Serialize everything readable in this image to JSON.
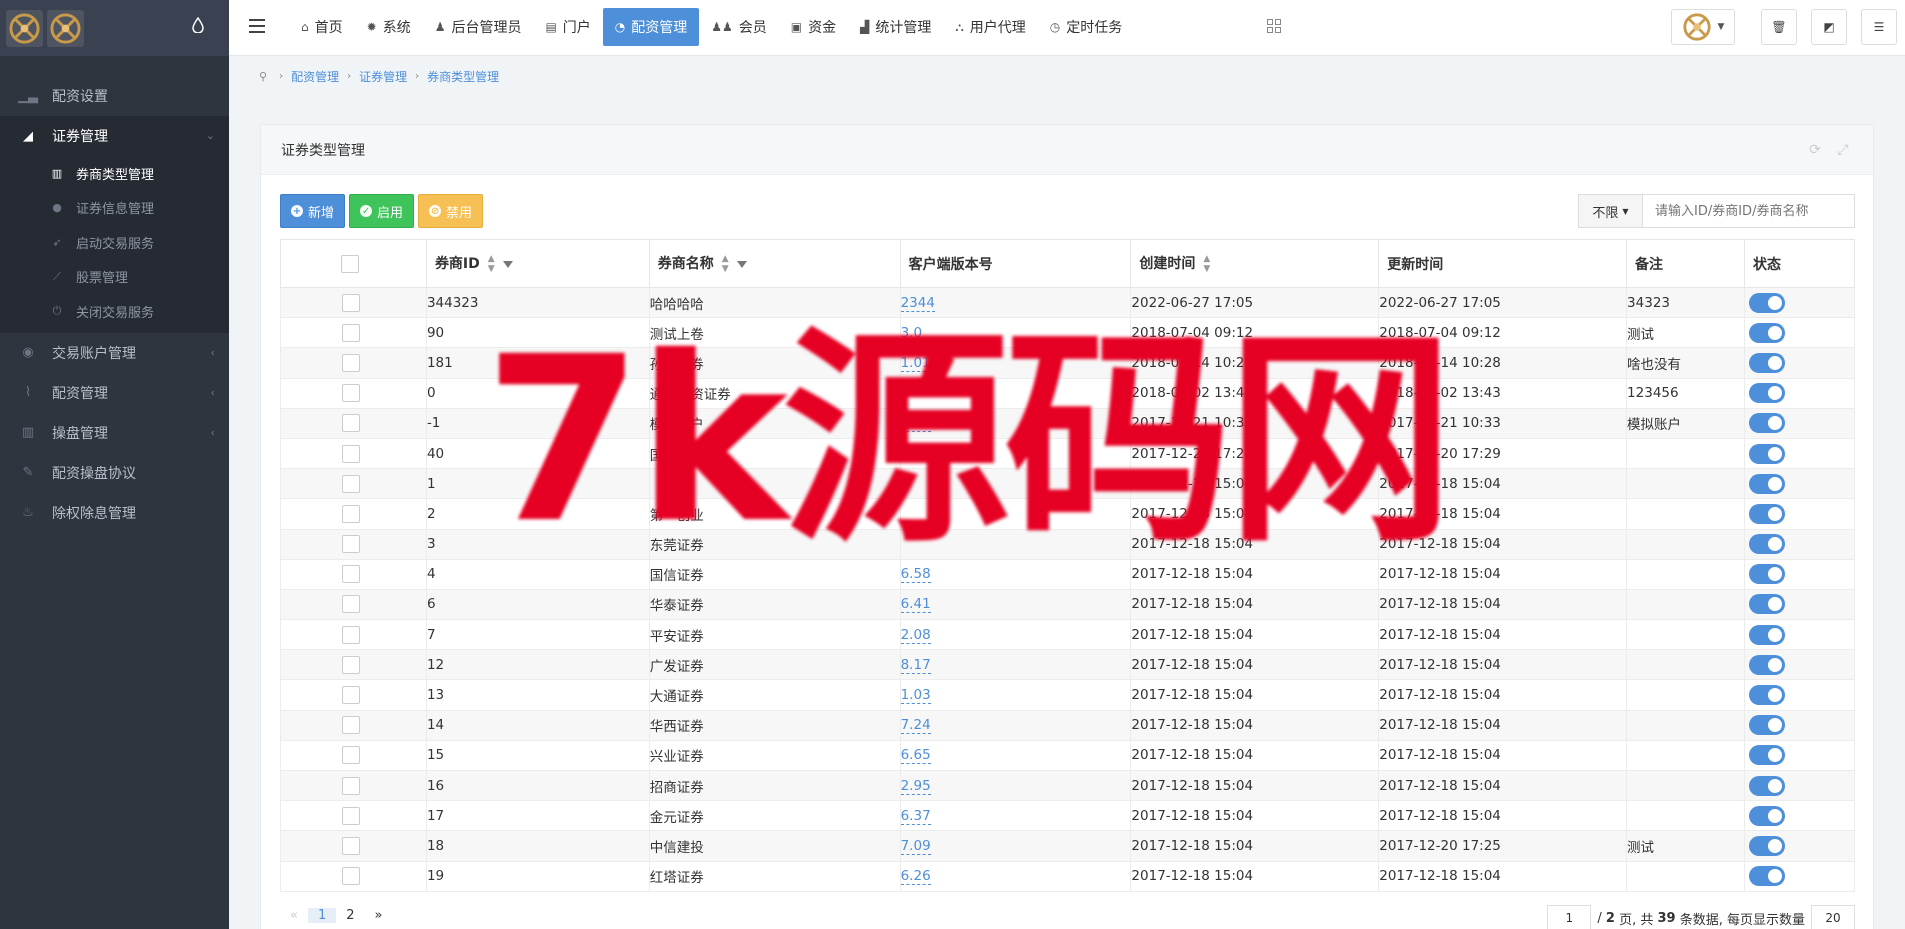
{
  "sidebar": {
    "menu": [
      {
        "label": "配资设置",
        "icon": "bar-chart-icon"
      },
      {
        "label": "证券管理",
        "icon": "area-chart-icon"
      },
      {
        "label": "交易账户管理",
        "icon": "user-circle-icon"
      },
      {
        "label": "配资管理",
        "icon": "paperclip-icon"
      },
      {
        "label": "操盘管理",
        "icon": "bank-icon"
      },
      {
        "label": "配资操盘协议",
        "icon": "pencil-icon"
      },
      {
        "label": "除权除息管理",
        "icon": "fire-icon"
      }
    ],
    "submenu": [
      {
        "label": "券商类型管理",
        "icon": "bank-icon"
      },
      {
        "label": "证券信息管理",
        "icon": "user-icon"
      },
      {
        "label": "启动交易服务",
        "icon": "rocket-icon"
      },
      {
        "label": "股票管理",
        "icon": "line-chart-icon"
      },
      {
        "label": "关闭交易服务",
        "icon": "power-icon"
      }
    ]
  },
  "topbar": {
    "nav": [
      {
        "label": "首页",
        "icon": "home-icon"
      },
      {
        "label": "系统",
        "icon": "gear-icon"
      },
      {
        "label": "后台管理员",
        "icon": "user-icon"
      },
      {
        "label": "门户",
        "icon": "newspaper-icon"
      },
      {
        "label": "配资管理",
        "icon": "pie-chart-icon"
      },
      {
        "label": "会员",
        "icon": "users-icon"
      },
      {
        "label": "资金",
        "icon": "money-icon"
      },
      {
        "label": "统计管理",
        "icon": "bar-chart-icon"
      },
      {
        "label": "用户代理",
        "icon": "sitemap-icon"
      },
      {
        "label": "定时任务",
        "icon": "clock-icon"
      }
    ]
  },
  "breadcrumb": [
    "配资管理",
    "证券管理",
    "券商类型管理"
  ],
  "panel": {
    "title": "证券类型管理",
    "buttons": {
      "add": "新增",
      "enable": "启用",
      "disable": "禁用"
    },
    "search": {
      "select_value": "不限",
      "placeholder": "请输入ID/券商ID/券商名称"
    }
  },
  "table": {
    "headers": {
      "id": "券商ID",
      "name": "券商名称",
      "version": "客户端版本号",
      "created": "创建时间",
      "updated": "更新时间",
      "remark": "备注",
      "status": "状态"
    },
    "rows": [
      {
        "id": "344323",
        "name": "哈哈哈哈",
        "version": "2344",
        "created": "2022-06-27 17:05",
        "updated": "2022-06-27 17:05",
        "remark": "34323"
      },
      {
        "id": "90",
        "name": "测试上卷",
        "version": "3.0",
        "created": "2018-07-04 09:12",
        "updated": "2018-07-04 09:12",
        "remark": "测试"
      },
      {
        "id": "181",
        "name": "孙凯证券",
        "version": "1.01",
        "created": "2018-06-14 10:28",
        "updated": "2018-06-14 10:28",
        "remark": "啥也没有"
      },
      {
        "id": "0",
        "name": "通道配资证券",
        "version": "",
        "created": "2018-06-02 13:43",
        "updated": "2018-06-02 13:43",
        "remark": "123456"
      },
      {
        "id": "-1",
        "name": "模拟账户",
        "version": "1.00",
        "created": "2017-12-21 10:33",
        "updated": "2017-12-21 10:33",
        "remark": "模拟账户"
      },
      {
        "id": "40",
        "name": "国金证券",
        "version": "",
        "created": "2017-12-20 17:28",
        "updated": "2017-12-20 17:29",
        "remark": ""
      },
      {
        "id": "1",
        "name": "",
        "version": "",
        "created": "2017-12-18 15:04",
        "updated": "2017-12-18 15:04",
        "remark": ""
      },
      {
        "id": "2",
        "name": "第一创业",
        "version": "",
        "created": "2017-12-18 15:04",
        "updated": "2017-12-18 15:04",
        "remark": ""
      },
      {
        "id": "3",
        "name": "东莞证券",
        "version": "",
        "created": "2017-12-18 15:04",
        "updated": "2017-12-18 15:04",
        "remark": ""
      },
      {
        "id": "4",
        "name": "国信证券",
        "version": "6.58",
        "created": "2017-12-18 15:04",
        "updated": "2017-12-18 15:04",
        "remark": ""
      },
      {
        "id": "6",
        "name": "华泰证券",
        "version": "6.41",
        "created": "2017-12-18 15:04",
        "updated": "2017-12-18 15:04",
        "remark": ""
      },
      {
        "id": "7",
        "name": "平安证券",
        "version": "2.08",
        "created": "2017-12-18 15:04",
        "updated": "2017-12-18 15:04",
        "remark": ""
      },
      {
        "id": "12",
        "name": "广发证券",
        "version": "8.17",
        "created": "2017-12-18 15:04",
        "updated": "2017-12-18 15:04",
        "remark": ""
      },
      {
        "id": "13",
        "name": "大通证券",
        "version": "1.03",
        "created": "2017-12-18 15:04",
        "updated": "2017-12-18 15:04",
        "remark": ""
      },
      {
        "id": "14",
        "name": "华西证券",
        "version": "7.24",
        "created": "2017-12-18 15:04",
        "updated": "2017-12-18 15:04",
        "remark": ""
      },
      {
        "id": "15",
        "name": "兴业证券",
        "version": "6.65",
        "created": "2017-12-18 15:04",
        "updated": "2017-12-18 15:04",
        "remark": ""
      },
      {
        "id": "16",
        "name": "招商证券",
        "version": "2.95",
        "created": "2017-12-18 15:04",
        "updated": "2017-12-18 15:04",
        "remark": ""
      },
      {
        "id": "17",
        "name": "金元证券",
        "version": "6.37",
        "created": "2017-12-18 15:04",
        "updated": "2017-12-18 15:04",
        "remark": ""
      },
      {
        "id": "18",
        "name": "中信建投",
        "version": "7.09",
        "created": "2017-12-18 15:04",
        "updated": "2017-12-20 17:25",
        "remark": "测试"
      },
      {
        "id": "19",
        "name": "红塔证券",
        "version": "6.26",
        "created": "2017-12-18 15:04",
        "updated": "2017-12-18 15:04",
        "remark": ""
      }
    ]
  },
  "pagination": {
    "prev": "«",
    "pages": [
      "1",
      "2"
    ],
    "next": "»",
    "current_input": "1",
    "total_text_prefix": "/",
    "total_pages": "2",
    "pages_suffix": "页, 共",
    "total_count": "39",
    "count_suffix": "条数据, 每页显示数量",
    "page_size": "20"
  },
  "watermark": "7k源码网",
  "colors": {
    "sidebar_bg": "#2f353e",
    "primary": "#4d8fd8",
    "success": "#3fc35b",
    "warning": "#f7c055",
    "watermark": "#e60023"
  }
}
